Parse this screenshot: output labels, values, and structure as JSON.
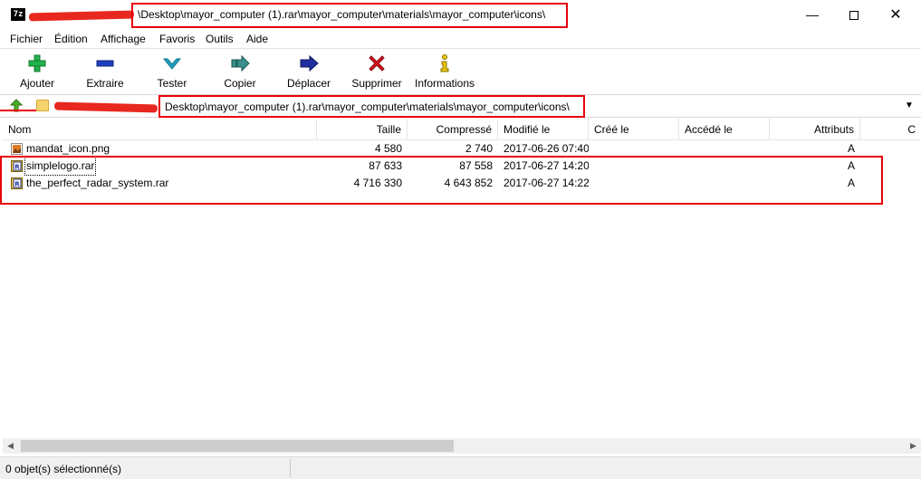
{
  "window": {
    "app_icon": "7z",
    "title_path": "\\Desktop\\mayor_computer (1).rar\\mayor_computer\\materials\\mayor_computer\\icons\\",
    "controls": {
      "minimize": "—",
      "maximize": "",
      "close": "✕"
    }
  },
  "menu": [
    "Fichier",
    "Édition",
    "Affichage",
    "Favoris",
    "Outils",
    "Aide"
  ],
  "toolbar": [
    {
      "label": "Ajouter",
      "icon": "plus-icon",
      "color": "#22b14c"
    },
    {
      "label": "Extraire",
      "icon": "minus-icon",
      "color": "#1f3fbf"
    },
    {
      "label": "Tester",
      "icon": "check-icon",
      "color": "#21a5c8"
    },
    {
      "label": "Copier",
      "icon": "copy-arrow-icon",
      "color": "#3a8f8a"
    },
    {
      "label": "Déplacer",
      "icon": "move-arrow-icon",
      "color": "#1f2f9f"
    },
    {
      "label": "Supprimer",
      "icon": "delete-x-icon",
      "color": "#d9141b"
    },
    {
      "label": "Informations",
      "icon": "info-icon",
      "color": "#e8c60e"
    }
  ],
  "address": {
    "path": "Desktop\\mayor_computer (1).rar\\mayor_computer\\materials\\mayor_computer\\icons\\"
  },
  "columns": [
    "Nom",
    "Taille",
    "Compressé",
    "Modifié le",
    "Créé le",
    "Accédé le",
    "Attributs",
    "C"
  ],
  "files": [
    {
      "name": "mandat_icon.png",
      "size": "4 580",
      "packed": "2 740",
      "modified": "2017-06-26 07:40",
      "created": "",
      "accessed": "",
      "attributes": "A",
      "icon": "image-file-icon"
    },
    {
      "name": "simplelogo.rar",
      "size": "87 633",
      "packed": "87 558",
      "modified": "2017-06-27 14:20",
      "created": "",
      "accessed": "",
      "attributes": "A",
      "icon": "rar-archive-icon"
    },
    {
      "name": "the_perfect_radar_system.rar",
      "size": "4 716 330",
      "packed": "4 643 852",
      "modified": "2017-06-27 14:22",
      "created": "",
      "accessed": "",
      "attributes": "A",
      "icon": "rar-archive-icon"
    }
  ],
  "status": {
    "text": "0 objet(s) sélectionné(s)"
  },
  "colors": {
    "annotation": "#e8000b"
  }
}
